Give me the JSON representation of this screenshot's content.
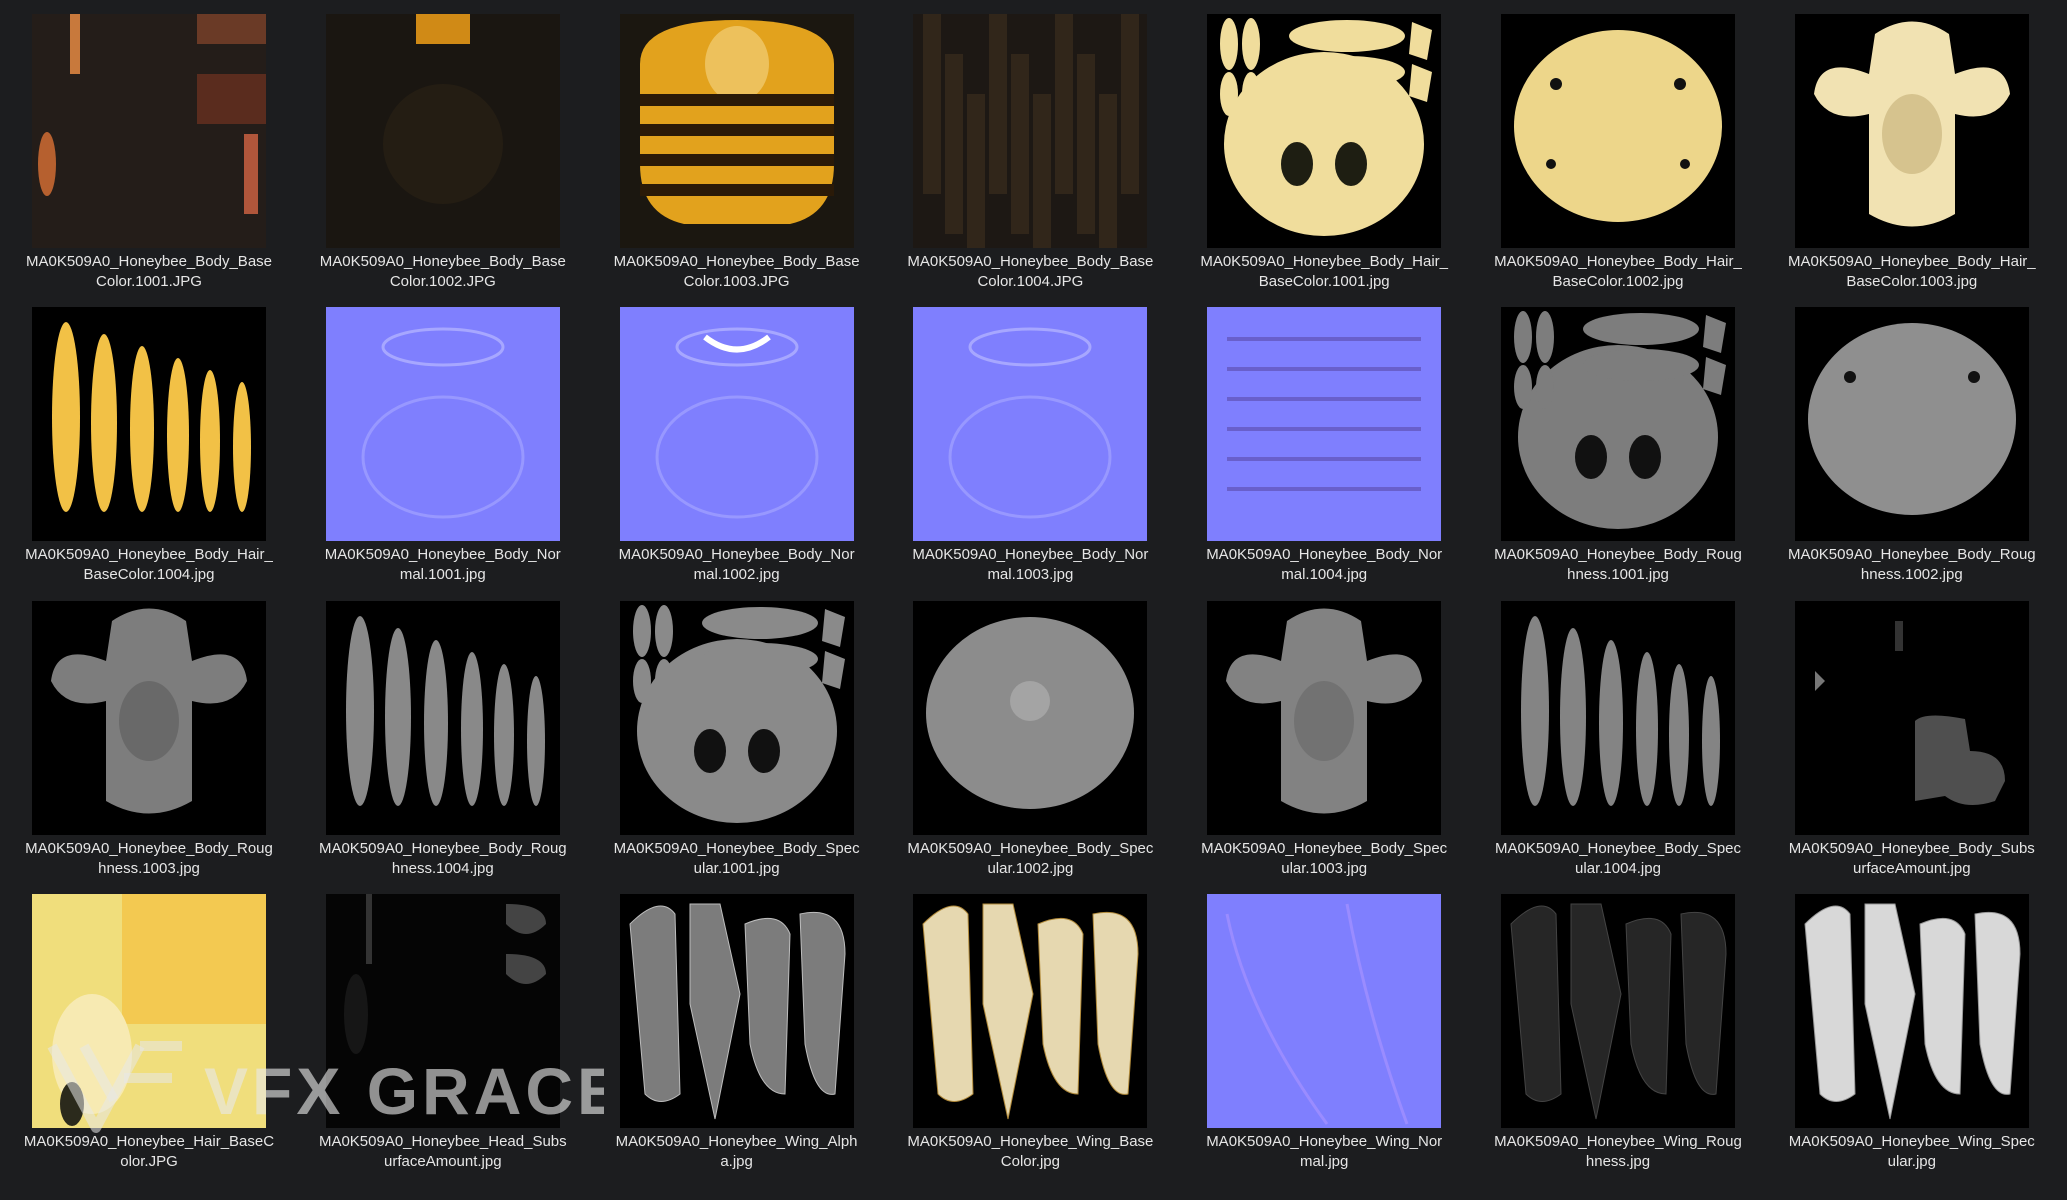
{
  "files": [
    {
      "name_l1": "MA0K509A0_Honeybee_Body_Base",
      "name_l2": "Color.1001.JPG",
      "icon": "body-basecolor-1001-thumbnail"
    },
    {
      "name_l1": "MA0K509A0_Honeybee_Body_Base",
      "name_l2": "Color.1002.JPG",
      "icon": "body-basecolor-1002-thumbnail"
    },
    {
      "name_l1": "MA0K509A0_Honeybee_Body_Base",
      "name_l2": "Color.1003.JPG",
      "icon": "body-basecolor-1003-thumbnail"
    },
    {
      "name_l1": "MA0K509A0_Honeybee_Body_Base",
      "name_l2": "Color.1004.JPG",
      "icon": "body-basecolor-1004-thumbnail"
    },
    {
      "name_l1": "MA0K509A0_Honeybee_Body_Hair_",
      "name_l2": "BaseColor.1001.jpg",
      "icon": "hair-basecolor-1001-thumbnail"
    },
    {
      "name_l1": "MA0K509A0_Honeybee_Body_Hair_",
      "name_l2": "BaseColor.1002.jpg",
      "icon": "hair-basecolor-1002-thumbnail"
    },
    {
      "name_l1": "MA0K509A0_Honeybee_Body_Hair_",
      "name_l2": "BaseColor.1003.jpg",
      "icon": "hair-basecolor-1003-thumbnail"
    },
    {
      "name_l1": "MA0K509A0_Honeybee_Body_Hair_",
      "name_l2": "BaseColor.1004.jpg",
      "icon": "hair-basecolor-1004-thumbnail"
    },
    {
      "name_l1": "MA0K509A0_Honeybee_Body_Nor",
      "name_l2": "mal.1001.jpg",
      "icon": "normal-1001-thumbnail"
    },
    {
      "name_l1": "MA0K509A0_Honeybee_Body_Nor",
      "name_l2": "mal.1002.jpg",
      "icon": "normal-1002-thumbnail"
    },
    {
      "name_l1": "MA0K509A0_Honeybee_Body_Nor",
      "name_l2": "mal.1003.jpg",
      "icon": "normal-1003-thumbnail"
    },
    {
      "name_l1": "MA0K509A0_Honeybee_Body_Nor",
      "name_l2": "mal.1004.jpg",
      "icon": "normal-1004-thumbnail"
    },
    {
      "name_l1": "MA0K509A0_Honeybee_Body_Roug",
      "name_l2": "hness.1001.jpg",
      "icon": "roughness-1001-thumbnail"
    },
    {
      "name_l1": "MA0K509A0_Honeybee_Body_Roug",
      "name_l2": "hness.1002.jpg",
      "icon": "roughness-1002-thumbnail"
    },
    {
      "name_l1": "MA0K509A0_Honeybee_Body_Roug",
      "name_l2": "hness.1003.jpg",
      "icon": "roughness-1003-thumbnail"
    },
    {
      "name_l1": "MA0K509A0_Honeybee_Body_Roug",
      "name_l2": "hness.1004.jpg",
      "icon": "roughness-1004-thumbnail"
    },
    {
      "name_l1": "MA0K509A0_Honeybee_Body_Spec",
      "name_l2": "ular.1001.jpg",
      "icon": "specular-1001-thumbnail"
    },
    {
      "name_l1": "MA0K509A0_Honeybee_Body_Spec",
      "name_l2": "ular.1002.jpg",
      "icon": "specular-1002-thumbnail"
    },
    {
      "name_l1": "MA0K509A0_Honeybee_Body_Spec",
      "name_l2": "ular.1003.jpg",
      "icon": "specular-1003-thumbnail"
    },
    {
      "name_l1": "MA0K509A0_Honeybee_Body_Spec",
      "name_l2": "ular.1004.jpg",
      "icon": "specular-1004-thumbnail"
    },
    {
      "name_l1": "MA0K509A0_Honeybee_Body_Subs",
      "name_l2": "urfaceAmount.jpg",
      "icon": "body-subsurface-thumbnail"
    },
    {
      "name_l1": "MA0K509A0_Honeybee_Hair_BaseC",
      "name_l2": "olor.JPG",
      "icon": "hair-basecolor-thumbnail"
    },
    {
      "name_l1": "MA0K509A0_Honeybee_Head_Subs",
      "name_l2": "urfaceAmount.jpg",
      "icon": "head-subsurface-thumbnail"
    },
    {
      "name_l1": "MA0K509A0_Honeybee_Wing_Alph",
      "name_l2": "a.jpg",
      "icon": "wing-alpha-thumbnail"
    },
    {
      "name_l1": "MA0K509A0_Honeybee_Wing_Base",
      "name_l2": "Color.jpg",
      "icon": "wing-basecolor-thumbnail"
    },
    {
      "name_l1": "MA0K509A0_Honeybee_Wing_Nor",
      "name_l2": "mal.jpg",
      "icon": "wing-normal-thumbnail"
    },
    {
      "name_l1": "MA0K509A0_Honeybee_Wing_Roug",
      "name_l2": "hness.jpg",
      "icon": "wing-roughness-thumbnail"
    },
    {
      "name_l1": "MA0K509A0_Honeybee_Wing_Spec",
      "name_l2": "ular.jpg",
      "icon": "wing-specular-thumbnail"
    }
  ],
  "watermark": {
    "text": "VFX GRACE",
    "icon": "vfx-grace-logo-icon"
  },
  "colors": {
    "background": "#1c1d1f",
    "label": "#e6e6e6",
    "normal_map": "#7f7ffe",
    "gold": "#e2a21d",
    "cream": "#eedfa6",
    "gray": "#8a8a8a"
  }
}
